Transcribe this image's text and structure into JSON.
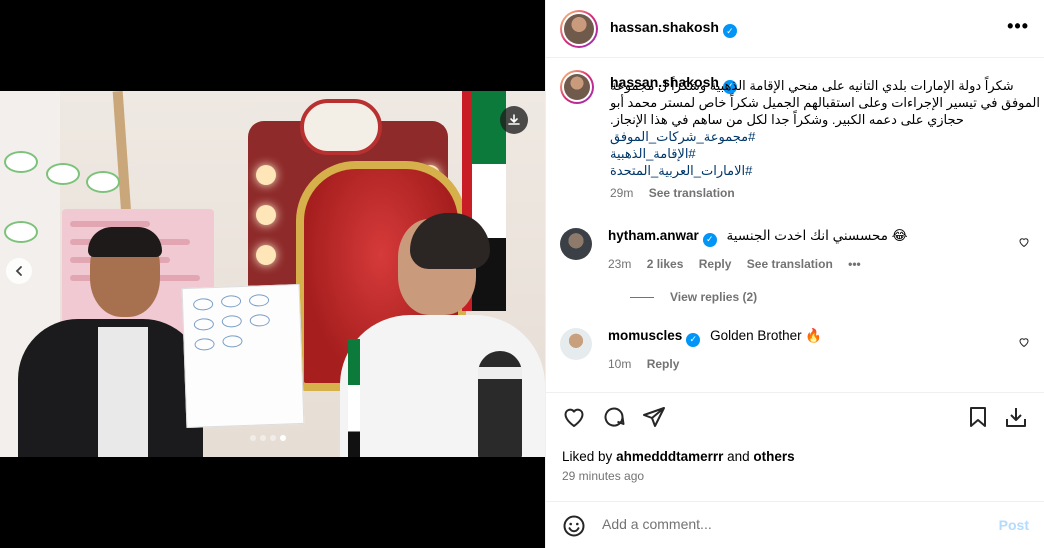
{
  "post": {
    "username": "hassan.shakosh",
    "more_icon": "more-horizontal-icon",
    "media": {
      "image_description_semantic": "photo",
      "download_icon": "download-icon",
      "prev_icon": "chevron-left-icon",
      "carousel_count": 4,
      "carousel_active_index": 4
    }
  },
  "caption": {
    "username": "hassan.shakosh",
    "text": "شكراً دولة الإمارات بلدي التانيه على منحي الإقامة الذهبية وشكراً ل مجموعة الموفق في تيسير الإجراءات وعلى استقبالهم الجميل شكراً خاص لمستر محمد أبو حجازي على دعمه الكبير. وشكراً جدا لكل من ساهم في هذا الإنجاز.",
    "hashtags": [
      "#مجموعة_شركات_الموفق",
      "#الإقامة_الذهبية",
      "#الامارات_العربية_المتحدة"
    ],
    "time": "29m",
    "see_translation": "See translation"
  },
  "comments": [
    {
      "username": "hytham.anwar",
      "text": "محسسني انك اخدت الجنسية 😂",
      "time": "23m",
      "likes": "2 likes",
      "reply": "Reply",
      "see_translation": "See translation",
      "more": "•••",
      "view_replies": "View replies (2)"
    },
    {
      "username": "momuscles",
      "text": "Golden Brother 🔥",
      "time": "10m",
      "reply": "Reply"
    }
  ],
  "actions": {
    "liked_by_prefix": "Liked by",
    "liked_by_user": "ahmedddtamerrr",
    "liked_by_and": "and",
    "liked_by_others": "others",
    "time_ago": "29 minutes ago",
    "add_comment_placeholder": "Add a comment...",
    "post_label": "Post"
  },
  "colors": {
    "verified": "#0095f6",
    "hashtag": "#00376b",
    "muted": "#737373",
    "post_disabled": "#b3dbff"
  }
}
